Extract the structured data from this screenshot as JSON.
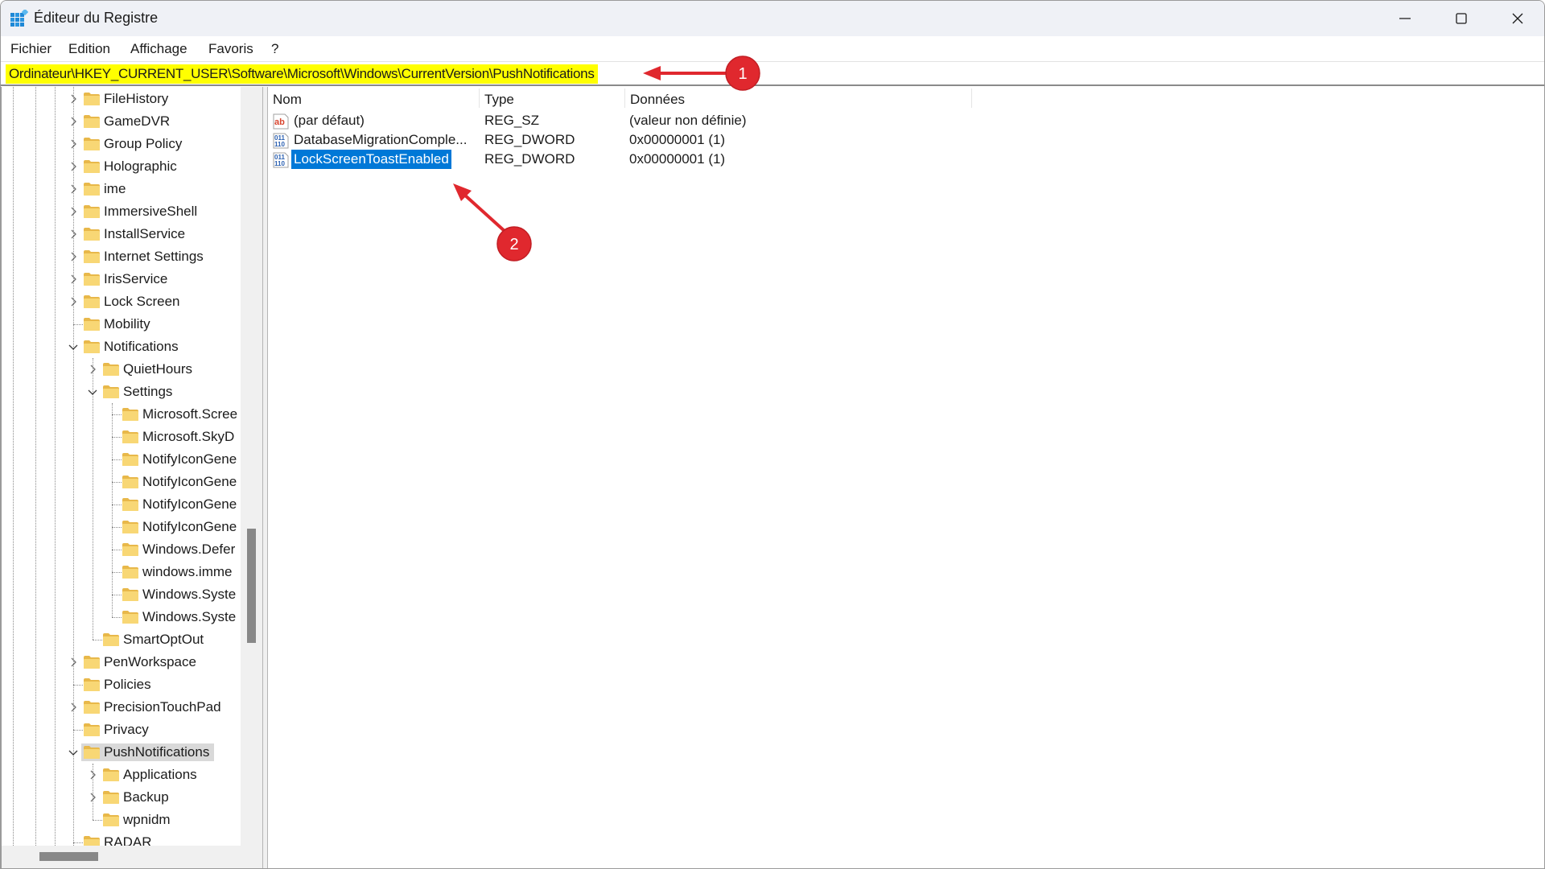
{
  "window": {
    "title": "Éditeur du Registre",
    "controls": {
      "minimize": "minimize-icon",
      "maximize": "maximize-icon",
      "close": "close-icon"
    }
  },
  "menu": [
    "Fichier",
    "Edition",
    "Affichage",
    "Favoris",
    "?"
  ],
  "address": "Ordinateur\\HKEY_CURRENT_USER\\Software\\Microsoft\\Windows\\CurrentVersion\\PushNotifications",
  "tree": [
    {
      "label": "FileHistory",
      "level": 0,
      "expander": "collapsed"
    },
    {
      "label": "GameDVR",
      "level": 0,
      "expander": "collapsed"
    },
    {
      "label": "Group Policy",
      "level": 0,
      "expander": "collapsed"
    },
    {
      "label": "Holographic",
      "level": 0,
      "expander": "collapsed"
    },
    {
      "label": "ime",
      "level": 0,
      "expander": "collapsed"
    },
    {
      "label": "ImmersiveShell",
      "level": 0,
      "expander": "collapsed"
    },
    {
      "label": "InstallService",
      "level": 0,
      "expander": "collapsed"
    },
    {
      "label": "Internet Settings",
      "level": 0,
      "expander": "collapsed"
    },
    {
      "label": "IrisService",
      "level": 0,
      "expander": "collapsed"
    },
    {
      "label": "Lock Screen",
      "level": 0,
      "expander": "collapsed"
    },
    {
      "label": "Mobility",
      "level": 0,
      "expander": "none"
    },
    {
      "label": "Notifications",
      "level": 0,
      "expander": "expanded"
    },
    {
      "label": "QuietHours",
      "level": 1,
      "expander": "collapsed"
    },
    {
      "label": "Settings",
      "level": 1,
      "expander": "expanded"
    },
    {
      "label": "Microsoft.Scree",
      "level": 2,
      "expander": "none"
    },
    {
      "label": "Microsoft.SkyD",
      "level": 2,
      "expander": "none"
    },
    {
      "label": "NotifyIconGene",
      "level": 2,
      "expander": "none"
    },
    {
      "label": "NotifyIconGene",
      "level": 2,
      "expander": "none"
    },
    {
      "label": "NotifyIconGene",
      "level": 2,
      "expander": "none"
    },
    {
      "label": "NotifyIconGene",
      "level": 2,
      "expander": "none"
    },
    {
      "label": "Windows.Defer",
      "level": 2,
      "expander": "none"
    },
    {
      "label": "windows.imme",
      "level": 2,
      "expander": "none"
    },
    {
      "label": "Windows.Syste",
      "level": 2,
      "expander": "none"
    },
    {
      "label": "Windows.Syste",
      "level": 2,
      "expander": "none"
    },
    {
      "label": "SmartOptOut",
      "level": 1,
      "expander": "none"
    },
    {
      "label": "PenWorkspace",
      "level": 0,
      "expander": "collapsed"
    },
    {
      "label": "Policies",
      "level": 0,
      "expander": "none"
    },
    {
      "label": "PrecisionTouchPad",
      "level": 0,
      "expander": "collapsed"
    },
    {
      "label": "Privacy",
      "level": 0,
      "expander": "none"
    },
    {
      "label": "PushNotifications",
      "level": 0,
      "expander": "expanded",
      "selected": true
    },
    {
      "label": "Applications",
      "level": 1,
      "expander": "collapsed"
    },
    {
      "label": "Backup",
      "level": 1,
      "expander": "collapsed"
    },
    {
      "label": "wpnidm",
      "level": 1,
      "expander": "none"
    },
    {
      "label": "RADAR",
      "level": 0,
      "expander": "none"
    }
  ],
  "columns": [
    "Nom",
    "Type",
    "Données"
  ],
  "values": [
    {
      "icon": "string-value-icon",
      "name": "(par défaut)",
      "type": "REG_SZ",
      "data": "(valeur non définie)"
    },
    {
      "icon": "binary-value-icon",
      "name": "DatabaseMigrationComple...",
      "type": "REG_DWORD",
      "data": "0x00000001 (1)"
    },
    {
      "icon": "binary-value-icon",
      "name": "LockScreenToastEnabled",
      "type": "REG_DWORD",
      "data": "0x00000001 (1)",
      "selected": true
    }
  ],
  "annotations": [
    {
      "number": "1",
      "target": "address-bar"
    },
    {
      "number": "2",
      "target": "LockScreenToastEnabled"
    }
  ],
  "colors": {
    "highlight_yellow": "#ffff00",
    "selection_blue": "#0078d7",
    "tree_selection_gray": "#d9d9d9",
    "annotation_red": "#e0282e",
    "folder_yellow": "#f8d775"
  }
}
